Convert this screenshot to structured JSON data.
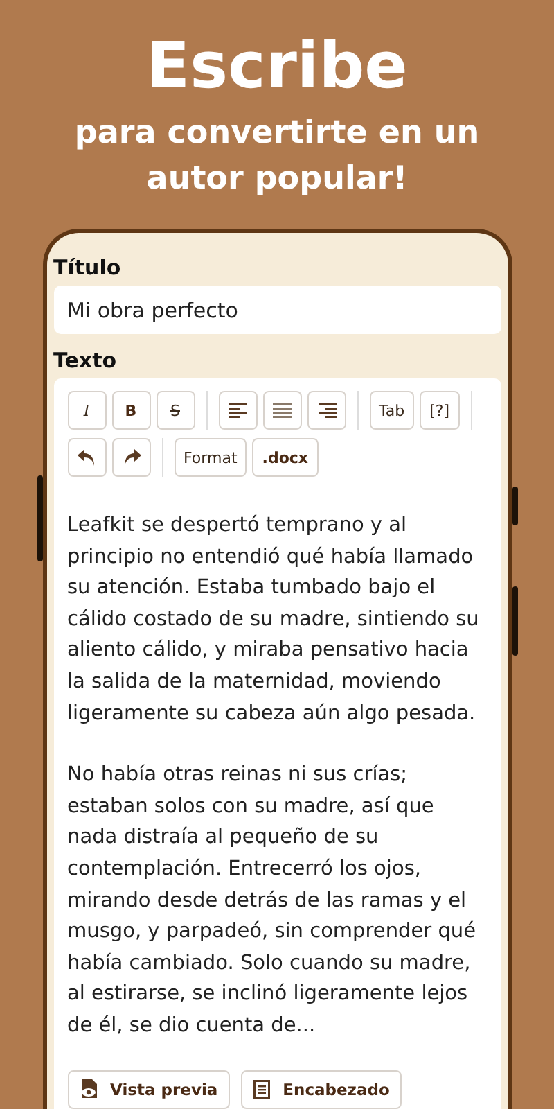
{
  "headline": "Escribe",
  "subheadline": "para convertirte en un autor popular!",
  "form": {
    "title_label": "Título",
    "title_value": "Mi obra perfecto",
    "text_label": "Texto",
    "toolbar": [
      [
        {
          "kind": "italic",
          "label": "I"
        },
        {
          "kind": "bold",
          "label": "B"
        },
        {
          "kind": "strike",
          "label": "S"
        }
      ],
      [
        {
          "kind": "align-left"
        },
        {
          "kind": "align-center"
        },
        {
          "kind": "align-right"
        }
      ],
      [
        {
          "kind": "text",
          "label": "Tab"
        },
        {
          "kind": "text",
          "label": "[?]"
        }
      ],
      [
        {
          "kind": "undo"
        },
        {
          "kind": "redo"
        }
      ],
      [
        {
          "kind": "text",
          "label": "Format"
        },
        {
          "kind": "strong",
          "label": ".docx"
        }
      ]
    ],
    "paragraphs": [
      "Leafkit se despertó temprano y al principio no entendió qué había llamado su atención. Estaba tumbado bajo el cálido costado de su madre, sintiendo su aliento cálido, y miraba pensativo hacia la salida de la maternidad, moviendo ligeramente su cabeza aún algo pesada.",
      "No había otras reinas ni sus crías; estaban solos con su madre, así que nada distraía al pequeño de su contemplación. Entrecerró los ojos, mirando desde detrás de las ramas y el musgo, y parpadeó, sin comprender qué había cambiado. Solo cuando su madre, al estirarse, se inclinó ligeramente lejos de él, se dio cuenta de..."
    ],
    "actions": [
      {
        "kind": "preview",
        "label": "Vista previa"
      },
      {
        "kind": "heading",
        "label": "Encabezado"
      }
    ]
  }
}
